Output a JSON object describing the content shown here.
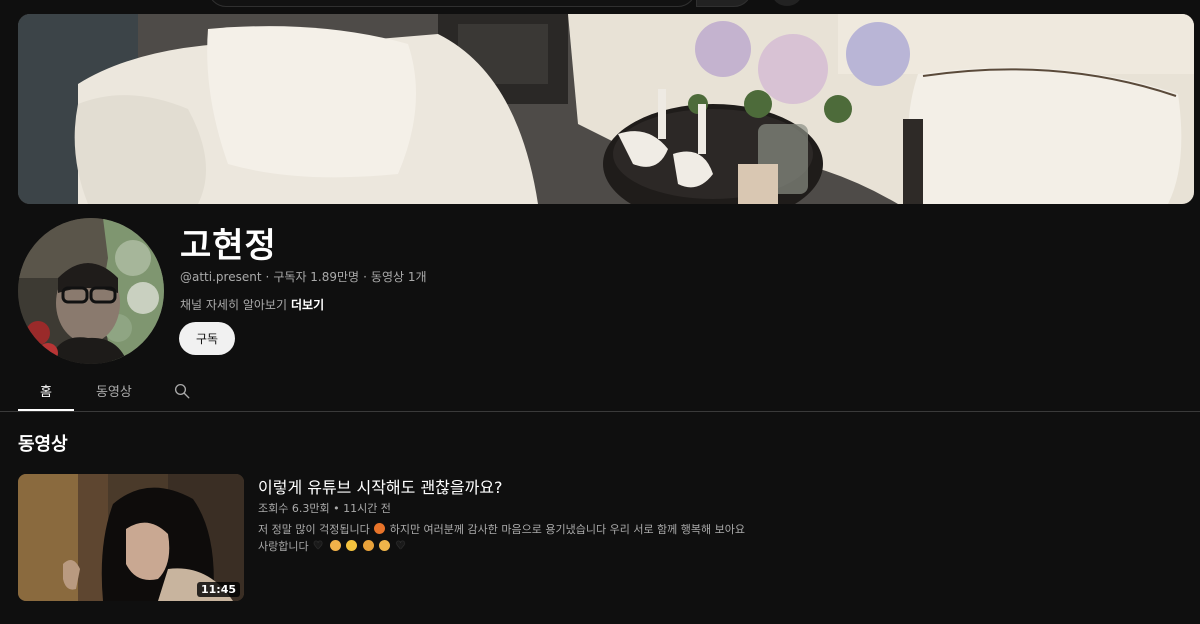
{
  "channel": {
    "name": "고현정",
    "handle": "@atti.present",
    "subscribers": "구독자 1.89만명",
    "video_count": "동영상 1개",
    "description": "채널 자세히 알아보기",
    "more_label": "더보기",
    "subscribe_label": "구독"
  },
  "tabs": [
    {
      "label": "홈",
      "active": true
    },
    {
      "label": "동영상",
      "active": false
    }
  ],
  "section": {
    "title": "동영상"
  },
  "video": {
    "title": "이렇게 유튜브 시작해도 괜찮을까요?",
    "views": "조회수 6.3만회",
    "age": "11시간 전",
    "desc_line1_a": "저 정말 많이 걱정됩니다",
    "desc_line1_b": "하지만 여러분께 감사한 마음으로 용기냈습니다 우리 서로 함께 행복해 보아요",
    "desc_line2": "사랑합니다",
    "duration": "11:45"
  },
  "colors": {
    "background": "#0f0f0f",
    "text": "#f1f1f1",
    "muted": "#aaaaaa",
    "button": "#f1f1f1"
  },
  "icons": {
    "search": "search-icon"
  }
}
